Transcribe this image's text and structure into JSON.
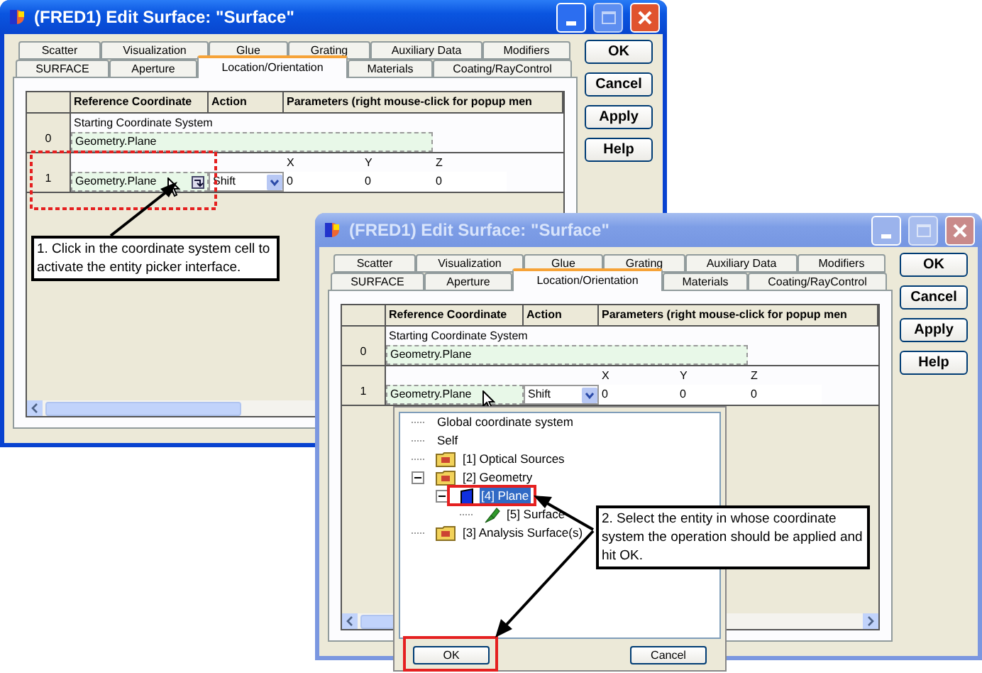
{
  "windows": [
    {
      "title": "(FRED1) Edit Surface: \"Surface\"",
      "active": true,
      "tab_rows": [
        [
          {
            "label": "Scatter",
            "selected": false
          },
          {
            "label": "Visualization",
            "selected": false
          },
          {
            "label": "Glue",
            "selected": false
          },
          {
            "label": "Grating",
            "selected": false
          },
          {
            "label": "Auxiliary Data",
            "selected": false
          },
          {
            "label": "Modifiers",
            "selected": false
          }
        ],
        [
          {
            "label": "SURFACE",
            "selected": false
          },
          {
            "label": "Aperture",
            "selected": false
          },
          {
            "label": "Location/Orientation",
            "selected": true
          },
          {
            "label": "Materials",
            "selected": false
          },
          {
            "label": "Coating/RayControl",
            "selected": false
          }
        ]
      ],
      "buttons": [
        "OK",
        "Cancel",
        "Apply",
        "Help"
      ],
      "columns": [
        "Reference Coordinate",
        "Action",
        "Parameters (right mouse-click for popup men"
      ],
      "rows": [
        {
          "number": "0",
          "caption": "Starting Coordinate System",
          "reference": "Geometry.Plane"
        },
        {
          "number": "1",
          "param_labels": [
            "X",
            "Y",
            "Z"
          ],
          "reference": "Geometry.Plane",
          "picker_shown": true,
          "action": "Shift",
          "values": [
            "0",
            "0",
            "0"
          ]
        }
      ]
    },
    {
      "title": "(FRED1) Edit Surface: \"Surface\"",
      "active": false,
      "tab_rows": [
        [
          {
            "label": "Scatter",
            "selected": false
          },
          {
            "label": "Visualization",
            "selected": false
          },
          {
            "label": "Glue",
            "selected": false
          },
          {
            "label": "Grating",
            "selected": false
          },
          {
            "label": "Auxiliary Data",
            "selected": false
          },
          {
            "label": "Modifiers",
            "selected": false
          }
        ],
        [
          {
            "label": "SURFACE",
            "selected": false
          },
          {
            "label": "Aperture",
            "selected": false
          },
          {
            "label": "Location/Orientation",
            "selected": true
          },
          {
            "label": "Materials",
            "selected": false
          },
          {
            "label": "Coating/RayControl",
            "selected": false
          }
        ]
      ],
      "buttons": [
        "OK",
        "Cancel",
        "Apply",
        "Help"
      ],
      "columns": [
        "Reference Coordinate",
        "Action",
        "Parameters (right mouse-click for popup men"
      ],
      "rows": [
        {
          "number": "0",
          "caption": "Starting Coordinate System",
          "reference": "Geometry.Plane"
        },
        {
          "number": "1",
          "param_labels": [
            "X",
            "Y",
            "Z"
          ],
          "reference": "Geometry.Plane",
          "picker_shown": false,
          "action": "Shift",
          "values": [
            "0",
            "0",
            "0"
          ]
        }
      ]
    }
  ],
  "picker": {
    "tree": [
      {
        "label": "Global coordinate system",
        "kind": "plain",
        "selected": false
      },
      {
        "label": "Self",
        "kind": "plain",
        "selected": false
      },
      {
        "label": "[1] Optical Sources",
        "kind": "folder",
        "selected": false
      },
      {
        "label": "[2] Geometry",
        "kind": "folder",
        "selected": false,
        "expanded": true,
        "children": [
          {
            "label": "[4] Plane",
            "kind": "plane",
            "selected": true,
            "expanded": true,
            "children": [
              {
                "label": "[5] Surface",
                "kind": "surface",
                "selected": false
              }
            ]
          }
        ]
      },
      {
        "label": "[3] Analysis Surface(s)",
        "kind": "folder",
        "selected": false
      }
    ],
    "buttons": [
      "OK",
      "Cancel"
    ]
  },
  "callouts": [
    "1.  Click in the coordinate system cell to activate the entity picker interface.",
    "2.  Select the entity in whose coordinate system the operation should be applied and hit OK."
  ]
}
